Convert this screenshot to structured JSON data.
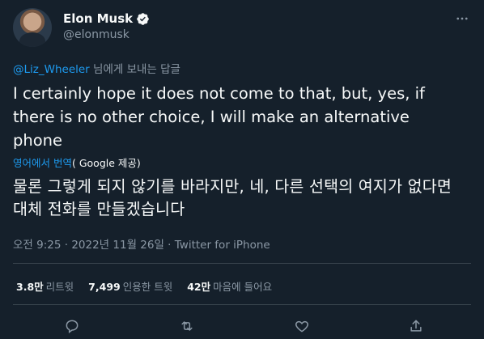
{
  "author": {
    "name": "Elon Musk",
    "handle": "@elonmusk"
  },
  "reply": {
    "mention": "@Liz_Wheeler",
    "suffix": " 님에게 보내는 답글"
  },
  "tweet": {
    "text": "I certainly hope it does not come to that, but, yes, if there is no other choice, I will make an alternative phone"
  },
  "translation": {
    "link": "영어에서 번역",
    "credit": "( Google 제공)",
    "text": "물론 그렇게 되지 않기를 바라지만, 네, 다른 선택의 여지가 없다면 대체 전화를 만들겠습니다"
  },
  "meta": {
    "time": "오전 9:25 · 2022년 11월 26일",
    "separator": " · ",
    "source": "Twitter for iPhone"
  },
  "stats": {
    "retweets_count": "3.8만",
    "retweets_label": "리트윗",
    "quotes_count": "7,499",
    "quotes_label": "인용한 트윗",
    "likes_count": "42만",
    "likes_label": "마음에 들어요"
  },
  "icons": {
    "more": "more-horizontal-icon",
    "verified": "verified-badge-icon",
    "reply": "reply-icon",
    "retweet": "retweet-icon",
    "like": "heart-icon",
    "share": "share-icon"
  },
  "colors": {
    "background": "#15202b",
    "accent": "#1d9bf0",
    "text": "#f7f9f9",
    "muted": "#8b98a5",
    "divider": "#38444d"
  }
}
